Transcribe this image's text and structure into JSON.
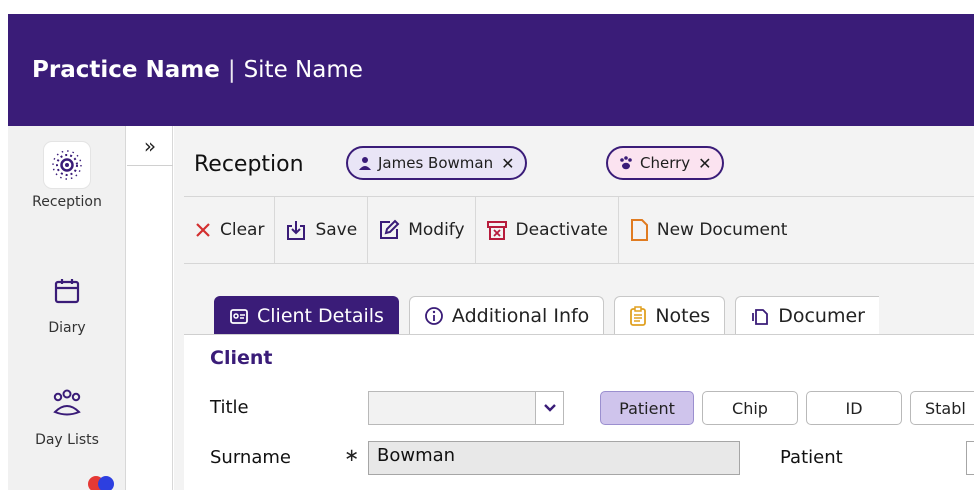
{
  "header": {
    "practice_name": "Practice Name",
    "separator": "|",
    "site_name": "Site Name"
  },
  "colors": {
    "brand": "#3a1c78",
    "patient_chip": "#fbe3f0",
    "client_chip": "#e9e5f6"
  },
  "sidebar": {
    "items": [
      {
        "label": "Reception",
        "icon": "reception-icon",
        "active": true
      },
      {
        "label": "Diary",
        "icon": "calendar-icon",
        "active": false
      },
      {
        "label": "Day Lists",
        "icon": "people-group-icon",
        "active": false
      }
    ],
    "collapse_label": "»"
  },
  "main": {
    "title": "Reception",
    "chips": [
      {
        "label": "James Bowman",
        "icon": "person-icon",
        "close": "✕"
      },
      {
        "label": "Cherry",
        "icon": "paw-icon",
        "close": "✕"
      }
    ]
  },
  "toolbar": {
    "clear": "Clear",
    "save": "Save",
    "modify": "Modify",
    "deactivate": "Deactivate",
    "new_document": "New Document"
  },
  "tabs": [
    {
      "label": "Client Details",
      "icon": "id-card-icon",
      "active": true
    },
    {
      "label": "Additional Info",
      "icon": "info-icon",
      "active": false
    },
    {
      "label": "Notes",
      "icon": "clipboard-icon",
      "active": false
    },
    {
      "label": "Documer",
      "icon": "documents-icon",
      "active": false
    }
  ],
  "form": {
    "section": "Client",
    "title_label": "Title",
    "title_value": "",
    "lookup_buttons": [
      "Patient",
      "Chip",
      "ID",
      "Stabl"
    ],
    "lookup_active": "Patient",
    "surname_label": "Surname",
    "surname_required": "∗",
    "surname_value": "Bowman",
    "patient_label": "Patient"
  }
}
